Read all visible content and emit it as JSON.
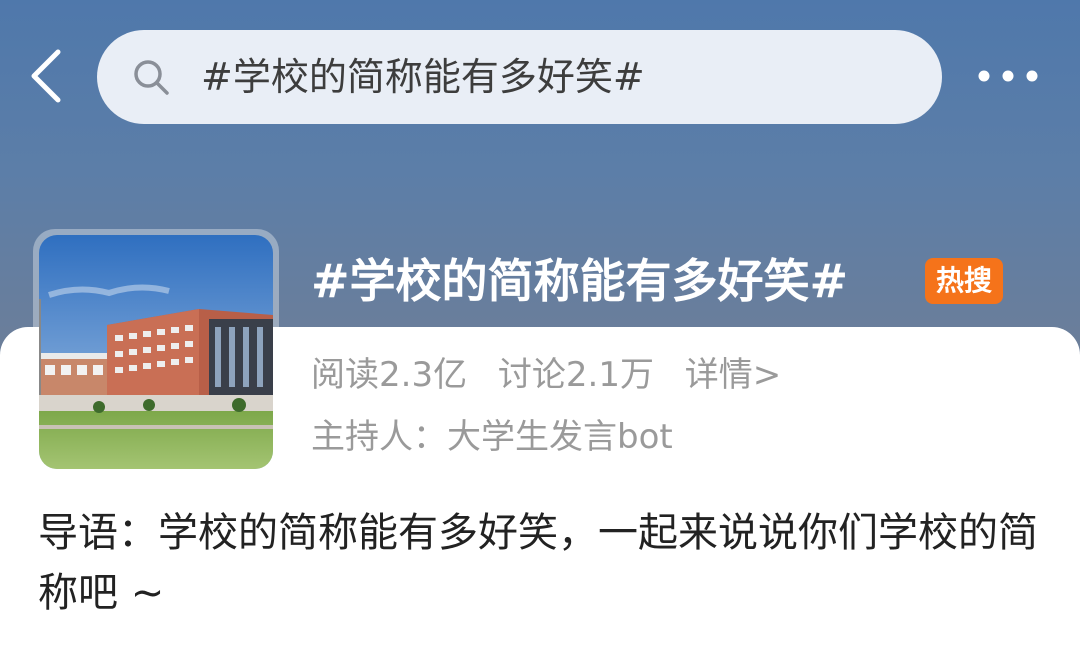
{
  "search": {
    "query": "#学校的简称能有多好笑#"
  },
  "topic": {
    "title": "#学校的简称能有多好笑#",
    "badge": "热搜",
    "reads": "阅读2.3亿",
    "discussions": "讨论2.1万",
    "details": "详情>",
    "host_label": "主持人：",
    "host_name": "大学生发言bot"
  },
  "intro": {
    "text": "导语：学校的简称能有多好笑，一起来说说你们学校的简称吧 ~"
  },
  "colors": {
    "header_top": "#4f78ab",
    "badge": "#f5731a",
    "muted_text": "#9a9a9a"
  },
  "icons": [
    "back-arrow-icon",
    "search-icon",
    "more-options-icon"
  ]
}
